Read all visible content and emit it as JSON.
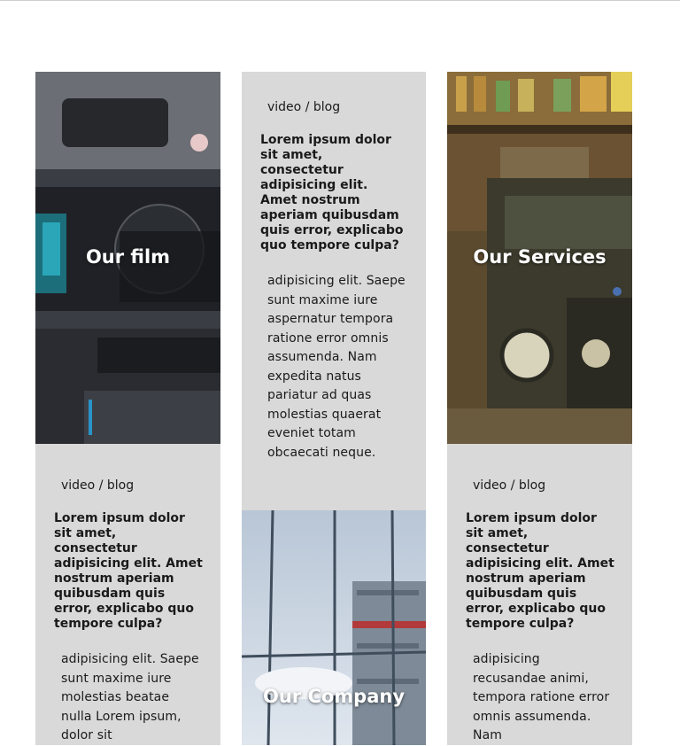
{
  "cards": [
    {
      "image_caption": "Our film",
      "meta": "video / blog",
      "headline": "Lorem ipsum dolor sit amet, consectetur adipisicing elit. Amet nostrum aperiam quibusdam quis error, explicabo quo tempore culpa?",
      "body": "adipisicing elit. Saepe sunt maxime iure molestias beatae nulla Lorem ipsum, dolor sit"
    },
    {
      "image_caption": "Our Company",
      "meta": "video / blog",
      "headline": "Lorem ipsum dolor sit amet, consectetur adipisicing elit. Amet nostrum aperiam quibusdam quis error, explicabo quo tempore culpa?",
      "body": "adipisicing elit. Saepe sunt maxime iure aspernatur tempora ratione error omnis assumenda. Nam expedita natus pariatur ad quas molestias quaerat eveniet totam obcaecati neque."
    },
    {
      "image_caption": "Our Services",
      "meta": "video / blog",
      "headline": "Lorem ipsum dolor sit amet, consectetur adipisicing elit. Amet nostrum aperiam quibusdam quis error, explicabo quo tempore culpa?",
      "body": "adipisicing recusandae animi, tempora ratione error omnis assumenda. Nam"
    }
  ]
}
